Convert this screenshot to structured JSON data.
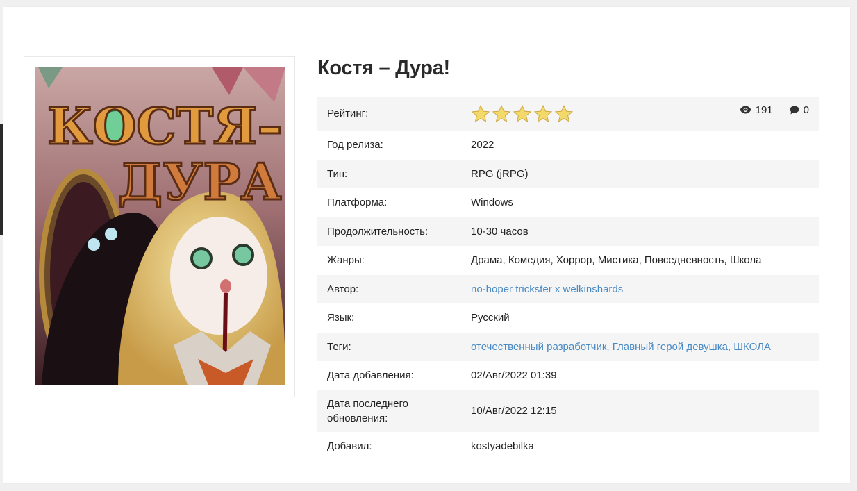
{
  "game": {
    "title": "Костя – Дура!"
  },
  "cover": {
    "title_line1": "КОСТЯ–",
    "title_line2": "ДУРА!"
  },
  "stats": {
    "views": "191",
    "comments": "0"
  },
  "rating": {
    "stars": 5,
    "max": 5
  },
  "info": {
    "rating_label": "Рейтинг:",
    "year_label": "Год релиза:",
    "year": "2022",
    "type_label": "Тип:",
    "type": "RPG (jRPG)",
    "platform_label": "Платформа:",
    "platform": "Windows",
    "duration_label": "Продолжительность:",
    "duration": "10-30 часов",
    "genres_label": "Жанры:",
    "genres": "Драма, Комедия, Хоррор, Мистика, Повседневность, Школа",
    "author_label": "Автор:",
    "author": "no-hoper trickster x welkinshards",
    "language_label": "Язык:",
    "language": "Русский",
    "tags_label": "Теги:",
    "tags": "отечественный разработчик, Главный герой девушка, ШКОЛА",
    "added_label": "Дата добавления:",
    "added": "02/Авг/2022 01:39",
    "updated_label": "Дата последнего обновления:",
    "updated": "10/Авг/2022 12:15",
    "added_by_label": "Добавил:",
    "added_by": "kostyadebilka"
  },
  "colors": {
    "link": "#4a8ac4",
    "star": "#f3d86a",
    "row_stripe": "#f5f5f5"
  }
}
